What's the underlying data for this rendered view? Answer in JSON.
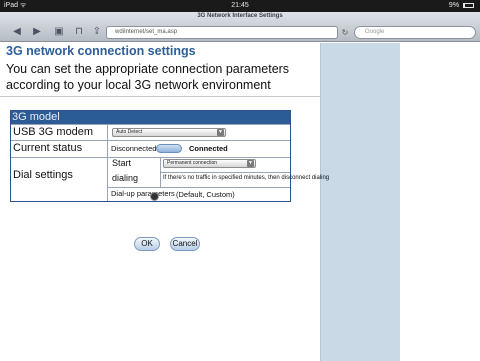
{
  "status_bar": {
    "device": "iPad ᯤ",
    "time": "21:45",
    "battery": "9%"
  },
  "browser": {
    "page_title": "3G Network Interface Settings",
    "url": "wdiInternet/set_ma.asp",
    "search_placeholder": "Google",
    "back_icon": "◀",
    "forward_icon": "▶",
    "pages_icon": "▣",
    "bookmarks_icon": "⊓",
    "share_icon": "⇪",
    "reload_icon": "↻"
  },
  "page": {
    "heading": "3G network connection settings",
    "description": "You can set the appropriate connection parameters according to your local 3G network environment"
  },
  "panel": {
    "title": "3G model",
    "usb_label": "USB 3G modem",
    "usb_select": "Auto Detect",
    "status_label": "Current status",
    "status_disconnected": "Disconnected",
    "status_connected": "Connected",
    "dial_label": "Dial settings",
    "start_dialing_label_1": "Start",
    "start_dialing_label_2": "dialing",
    "start_select": "Permanent connection",
    "idle_note": "If there's no traffic in specified minutes, then disconnect dialing",
    "dialup_params": "Dial-up parameters",
    "dialup_mode": "(Default, Custom)"
  },
  "buttons": {
    "ok": "OK",
    "cancel": "Cancel"
  }
}
